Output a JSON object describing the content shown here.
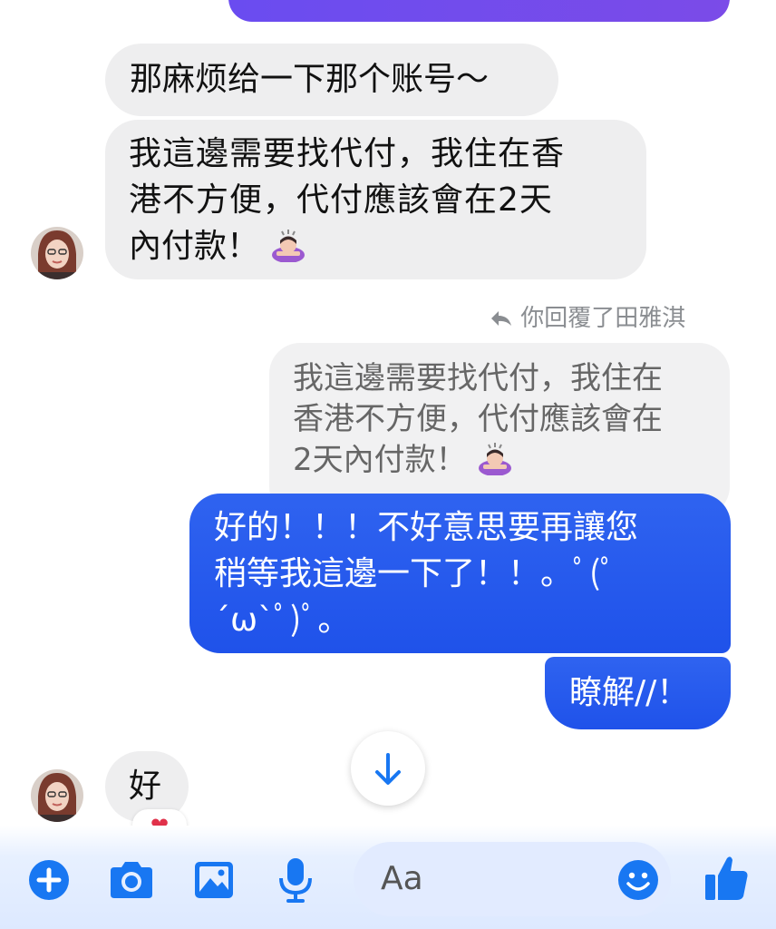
{
  "messages": {
    "top_outgoing_stub": "",
    "incoming_1": "那麻烦给一下那个账号～",
    "incoming_2_line1": "我這邊需要找代付，我住在香",
    "incoming_2_line2": "港不方便，代付應該會在2天",
    "incoming_2_line3": "內付款！",
    "reply_label": "你回覆了田雅淇",
    "quoted_line1": "我這邊需要找代付，我住在",
    "quoted_line2": "香港不方便，代付應該會在",
    "quoted_line3": "2天內付款！",
    "outgoing_1_line1": "好的！！！不好意思要再讓您",
    "outgoing_1_line2": "稍等我這邊一下了！！。ﾟ(ﾟ",
    "outgoing_1_line3": "´ω`ﾟ)ﾟ。",
    "outgoing_2": "瞭解//！",
    "incoming_3": "好",
    "reaction": "❤"
  },
  "composer": {
    "placeholder": "Aa"
  },
  "colors": {
    "accent": "#1877f2",
    "outgoing_bubble": "#2557ec",
    "incoming_bubble": "#eeeeef"
  },
  "icons": {
    "add": "plus-circle-icon",
    "camera": "camera-icon",
    "gallery": "image-icon",
    "mic": "microphone-icon",
    "emoji": "smiley-icon",
    "like": "thumbs-up-icon",
    "scroll": "arrow-down-icon",
    "reply": "reply-arrow-icon"
  }
}
